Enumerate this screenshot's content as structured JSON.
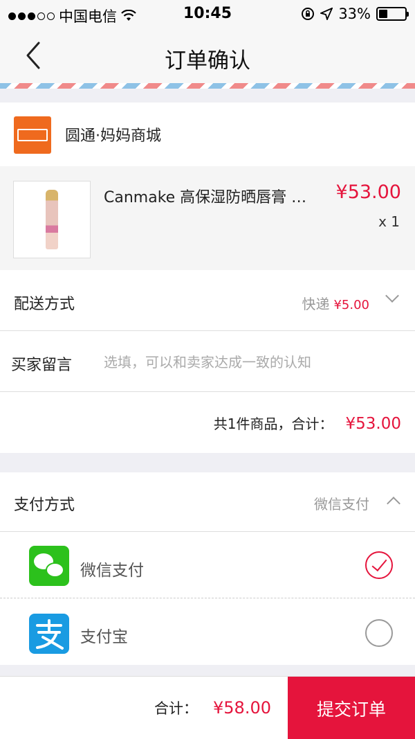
{
  "status_bar": {
    "carrier": "中国电信",
    "time": "10:45",
    "battery": "33%",
    "battery_level": 0.33
  },
  "nav": {
    "title": "订单确认",
    "back_icon": "chevron-left-icon"
  },
  "shop": {
    "name": "圆通·妈妈商城",
    "logo_color": "#ef6a1e"
  },
  "product": {
    "name": "Canmake 高保湿防晒唇膏 …",
    "price": "¥53.00",
    "quantity": "x 1"
  },
  "delivery": {
    "label": "配送方式",
    "method": "快递",
    "fee": "¥5.00"
  },
  "message": {
    "label": "买家留言",
    "placeholder": "选填，可以和卖家达成一致的认知",
    "value": ""
  },
  "summary": {
    "text": "共1件商品，合计：",
    "amount": "¥53.00"
  },
  "payment": {
    "label": "支付方式",
    "selected": "微信支付",
    "options": [
      {
        "name": "微信支付",
        "icon": "wechat-icon",
        "checked": true
      },
      {
        "name": "支付宝",
        "icon": "alipay-icon",
        "checked": false
      }
    ]
  },
  "bottom_bar": {
    "total_label": "合计：",
    "total_amount": "¥58.00",
    "submit_label": "提交订单"
  },
  "colors": {
    "accent": "#e5143c",
    "wechat": "#2cc11c",
    "alipay": "#199be2"
  }
}
